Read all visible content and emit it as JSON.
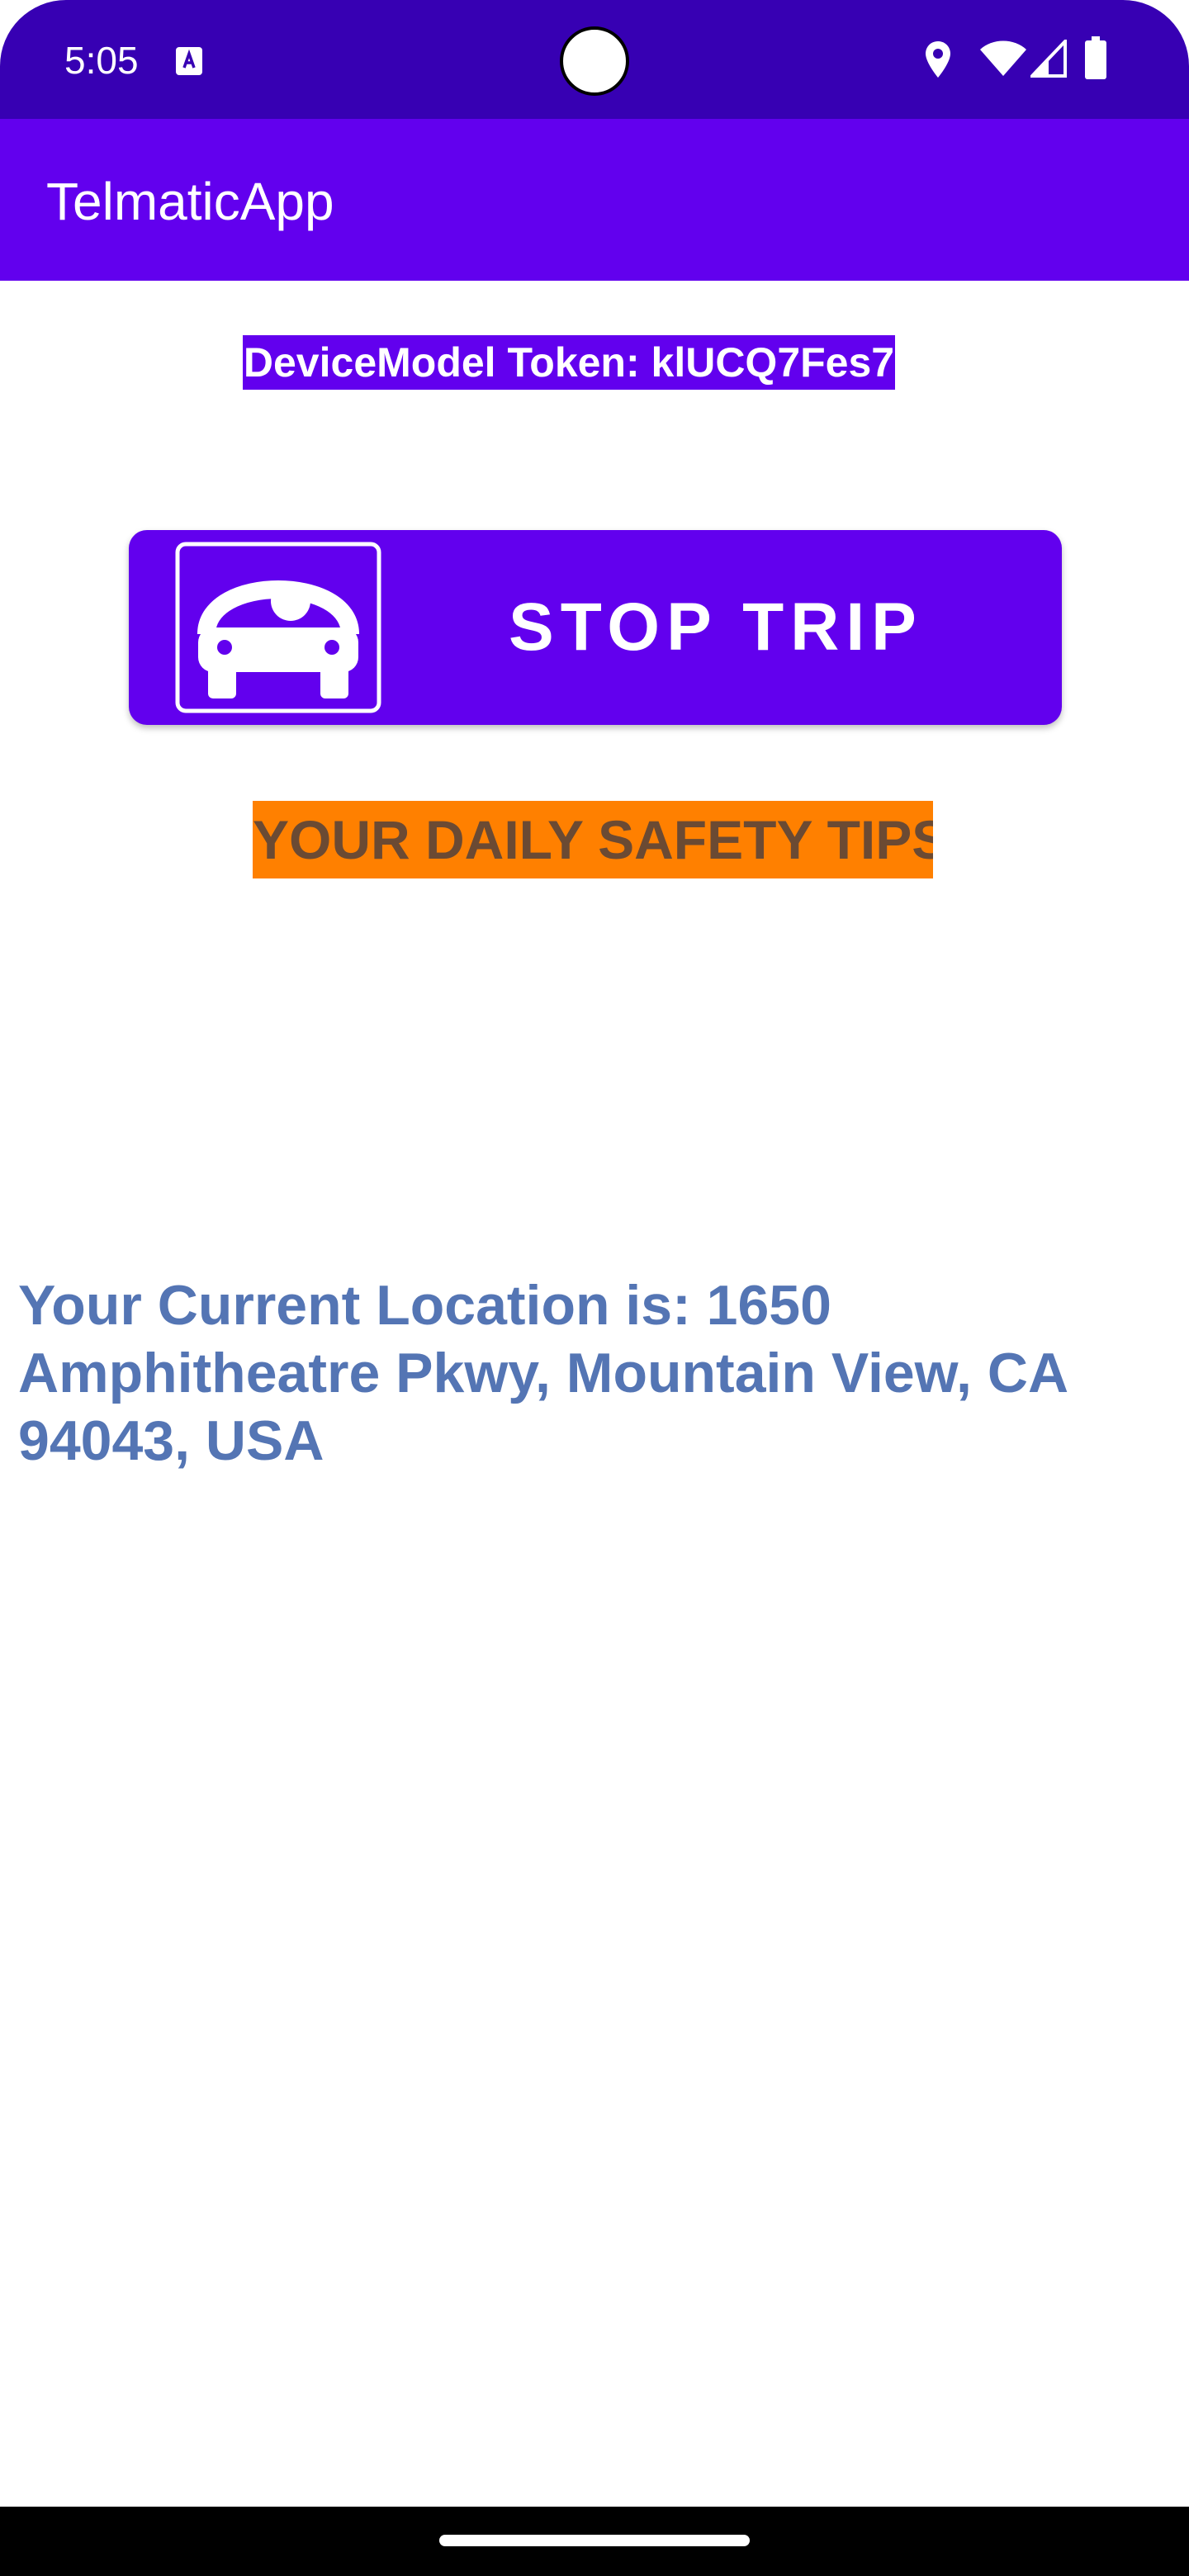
{
  "status_bar": {
    "time": "5:05",
    "icons": [
      "notification-app-icon",
      "location-icon",
      "wifi-icon",
      "signal-icon",
      "battery-icon"
    ]
  },
  "app_bar": {
    "title": "TelmaticApp"
  },
  "main": {
    "token_label": "DeviceModel Token: klUCQ7Fes7",
    "stop_trip_button": {
      "label": "STOP TRIP",
      "icon": "car-driver-icon"
    },
    "safety_tips_label": "YOUR DAILY SAFETY TIPS",
    "location_text": "Your Current Location is: 1650 Amphitheatre Pkwy, Mountain View, CA 94043, USA"
  },
  "colors": {
    "status_bar": "#3700b3",
    "primary": "#6200ee",
    "safety_tips_bg": "#ff8000",
    "safety_tips_text": "#6b4a33",
    "location_text": "#5475b4"
  }
}
